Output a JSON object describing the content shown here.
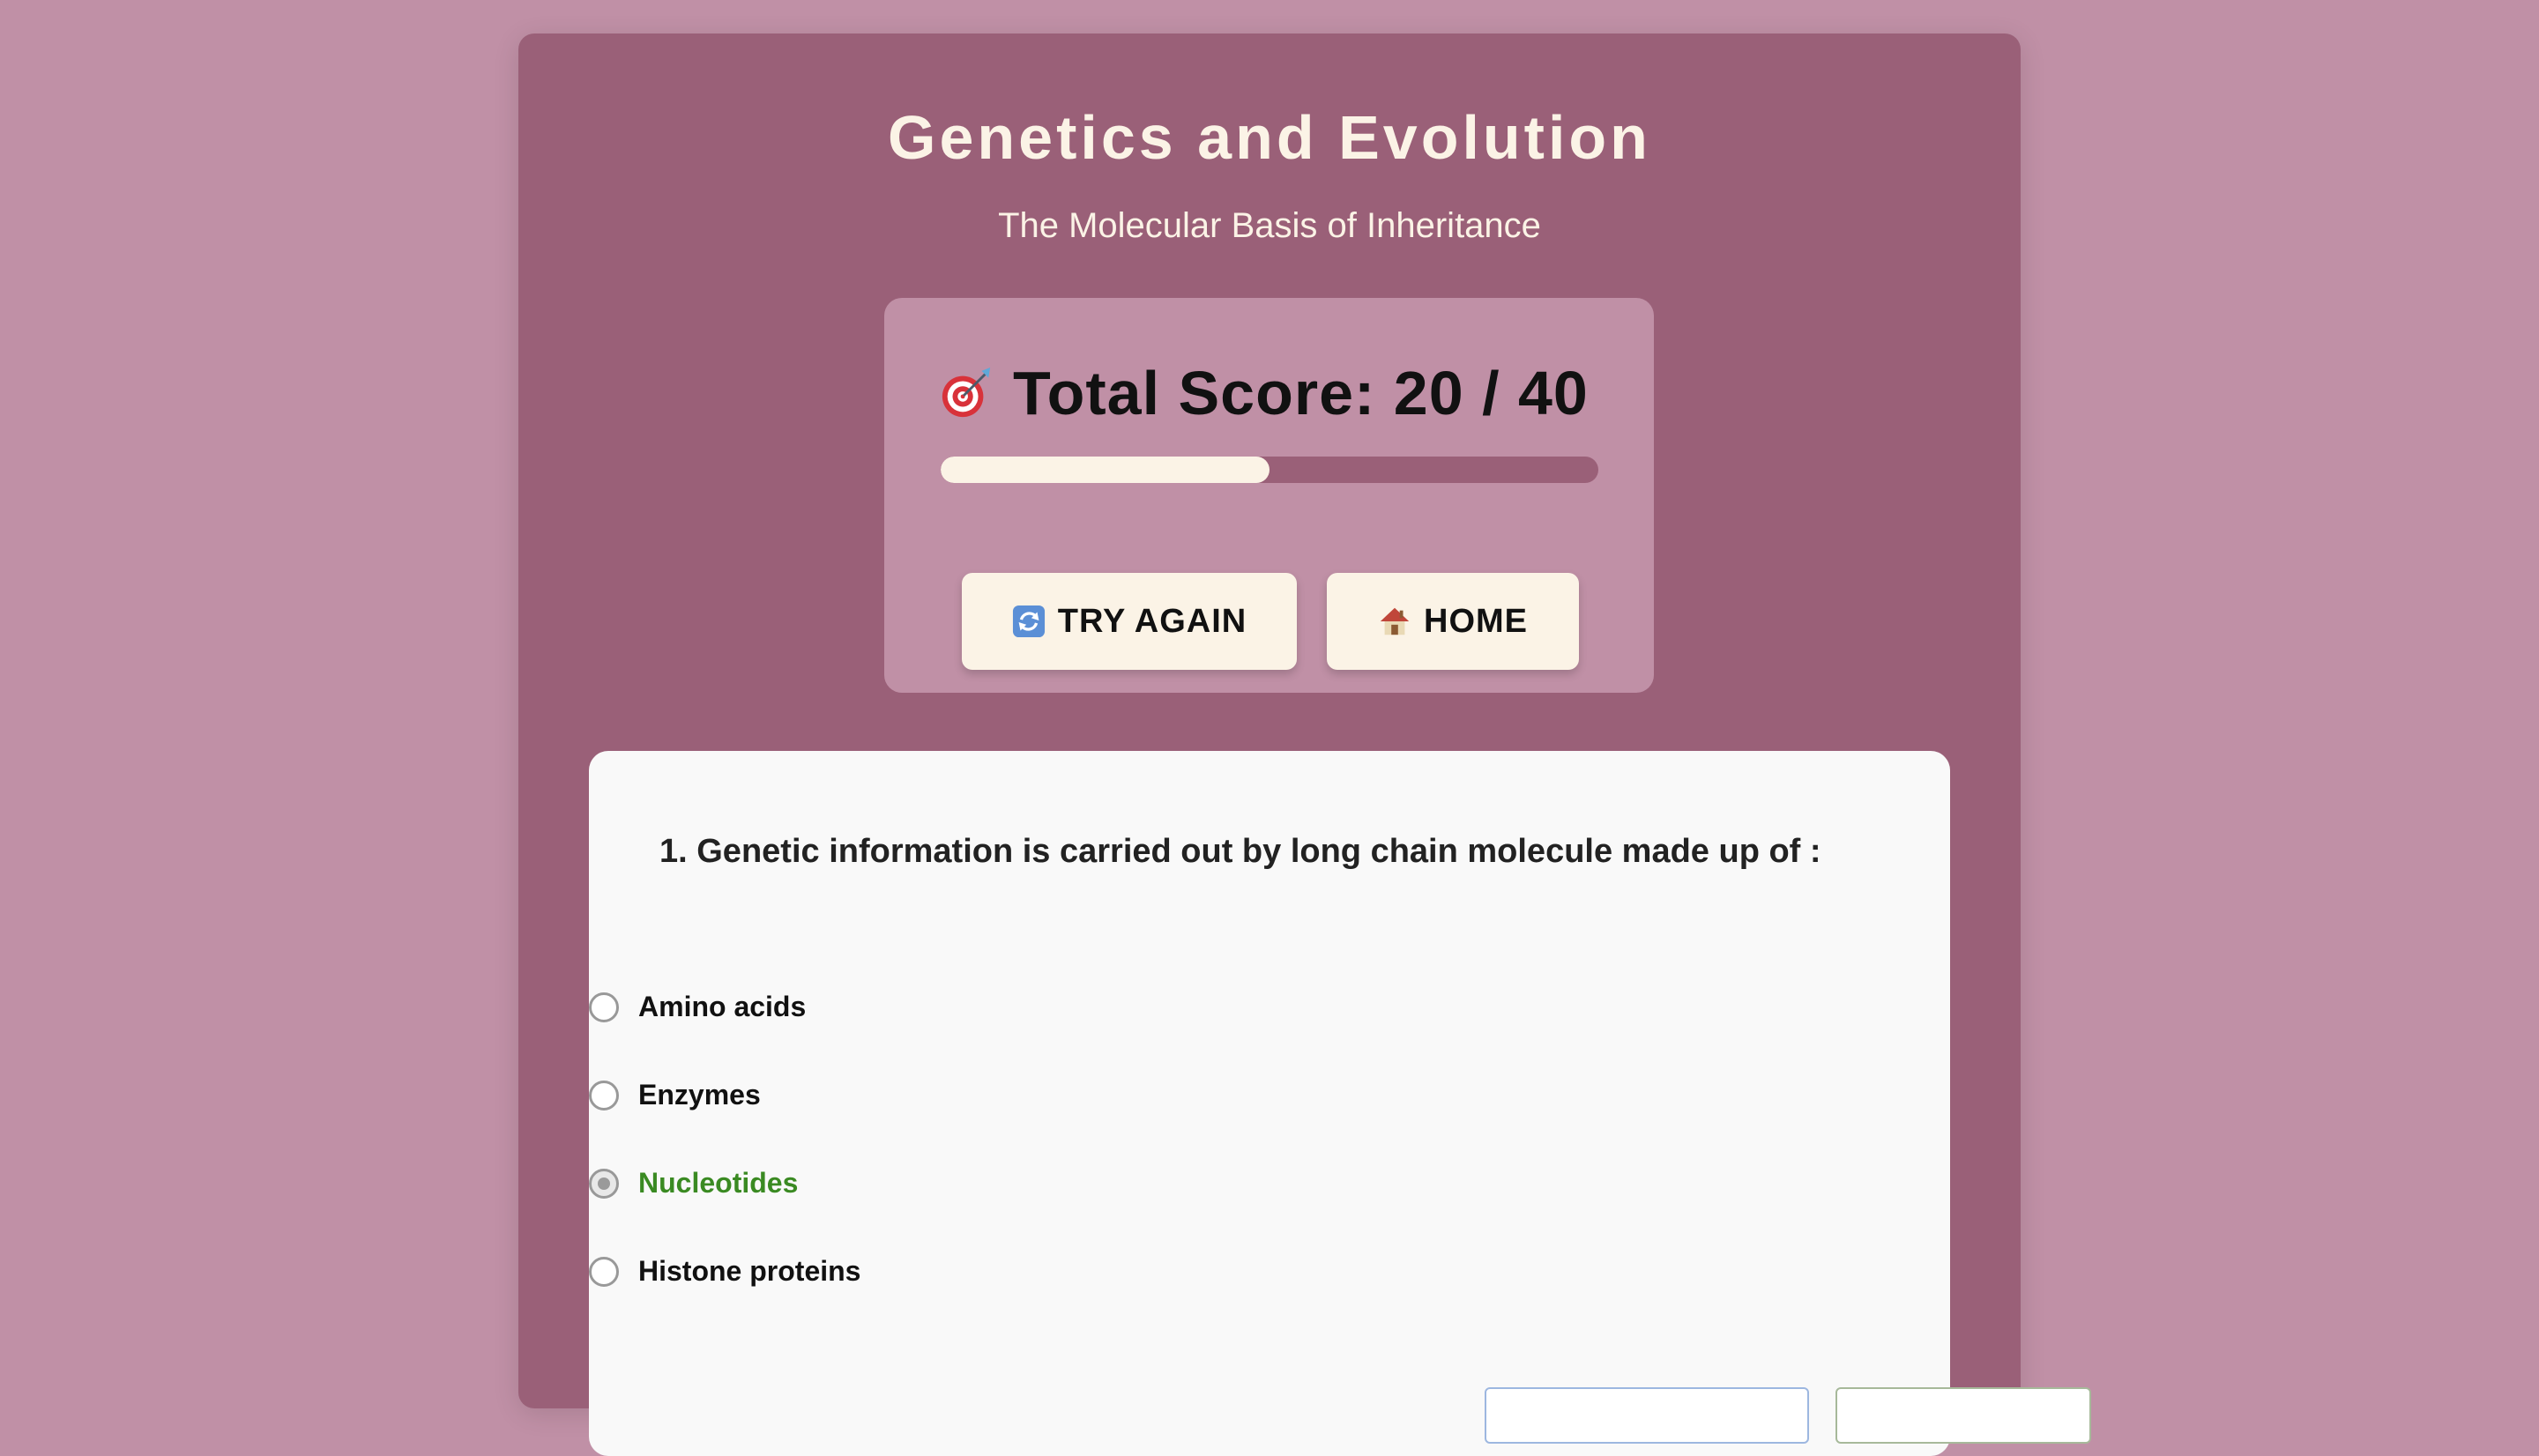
{
  "header": {
    "title": "Genetics and Evolution",
    "subtitle": "The Molecular Basis of Inheritance"
  },
  "score": {
    "label": "Total Score: 20 / 40",
    "icon": "target-dart-icon",
    "progress_fraction": 0.5,
    "try_again_label": "TRY AGAIN",
    "try_again_icon": "refresh-icon",
    "home_label": "HOME",
    "home_icon": "house-icon"
  },
  "question": {
    "text": "1. Genetic information is carried out by long chain molecule made up of :",
    "options": [
      {
        "label": "Amino acids",
        "selected": false,
        "correct": false
      },
      {
        "label": "Enzymes",
        "selected": false,
        "correct": false
      },
      {
        "label": "Nucleotides",
        "selected": true,
        "correct": true
      },
      {
        "label": "Histone proteins",
        "selected": false,
        "correct": false
      }
    ]
  },
  "colors": {
    "background": "#c090a6",
    "panel": "#9a6078",
    "cream": "#fbf3e6",
    "correct": "#3a8a22"
  }
}
